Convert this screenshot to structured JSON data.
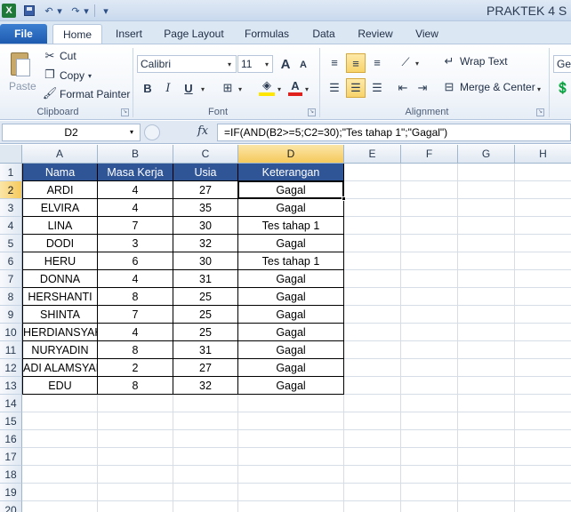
{
  "window": {
    "title": "PRAKTEK 4 S",
    "app_icon": "X"
  },
  "quick_access": {
    "undo_glyph": "↶",
    "redo_glyph": "↷",
    "dropdown_glyph": "▾",
    "customize_glyph": "▾"
  },
  "tabs": [
    {
      "label": "File"
    },
    {
      "label": "Home"
    },
    {
      "label": "Insert"
    },
    {
      "label": "Page Layout"
    },
    {
      "label": "Formulas"
    },
    {
      "label": "Data"
    },
    {
      "label": "Review"
    },
    {
      "label": "View"
    }
  ],
  "ribbon": {
    "clipboard": {
      "paste": "Paste",
      "cut": "Cut",
      "copy": "Copy",
      "format_painter": "Format Painter",
      "group_label": "Clipboard"
    },
    "font": {
      "font_name": "Calibri",
      "font_size": "11",
      "bold": "B",
      "italic": "I",
      "underline": "U",
      "grow": "A",
      "shrink": "A",
      "font_color_letter": "A",
      "group_label": "Font"
    },
    "alignment": {
      "wrap_text": "Wrap Text",
      "merge_center": "Merge & Center",
      "group_label": "Alignment"
    },
    "number": {
      "format_partial": "Ger"
    }
  },
  "formula_bar": {
    "name_box": "D2",
    "fx": "fx",
    "formula": "=IF(AND(B2>=5;C2=30);\"Tes tahap 1\";\"Gagal\")"
  },
  "sheet": {
    "columns": [
      "A",
      "B",
      "C",
      "D",
      "E",
      "F",
      "G",
      "H"
    ],
    "rows": [
      "1",
      "2",
      "3",
      "4",
      "5",
      "6",
      "7",
      "8",
      "9",
      "10",
      "11",
      "12",
      "13",
      "14",
      "15",
      "16",
      "17",
      "18",
      "19",
      "20"
    ],
    "header": [
      "Nama",
      "Masa Kerja",
      "Usia",
      "Keterangan"
    ],
    "data": [
      [
        "ARDI",
        "4",
        "27",
        "Gagal"
      ],
      [
        "ELVIRA",
        "4",
        "35",
        "Gagal"
      ],
      [
        "LINA",
        "7",
        "30",
        "Tes tahap 1"
      ],
      [
        "DODI",
        "3",
        "32",
        "Gagal"
      ],
      [
        "HERU",
        "6",
        "30",
        "Tes tahap 1"
      ],
      [
        "DONNA",
        "4",
        "31",
        "Gagal"
      ],
      [
        "HERSHANTI",
        "8",
        "25",
        "Gagal"
      ],
      [
        "SHINTA",
        "7",
        "25",
        "Gagal"
      ],
      [
        "HERDIANSYAH",
        "4",
        "25",
        "Gagal"
      ],
      [
        "NURYADIN",
        "8",
        "31",
        "Gagal"
      ],
      [
        "ADI ALAMSYAH",
        "2",
        "27",
        "Gagal"
      ],
      [
        "EDU",
        "8",
        "32",
        "Gagal"
      ]
    ],
    "header_color": "#2f5597",
    "active_cell": "D2"
  }
}
